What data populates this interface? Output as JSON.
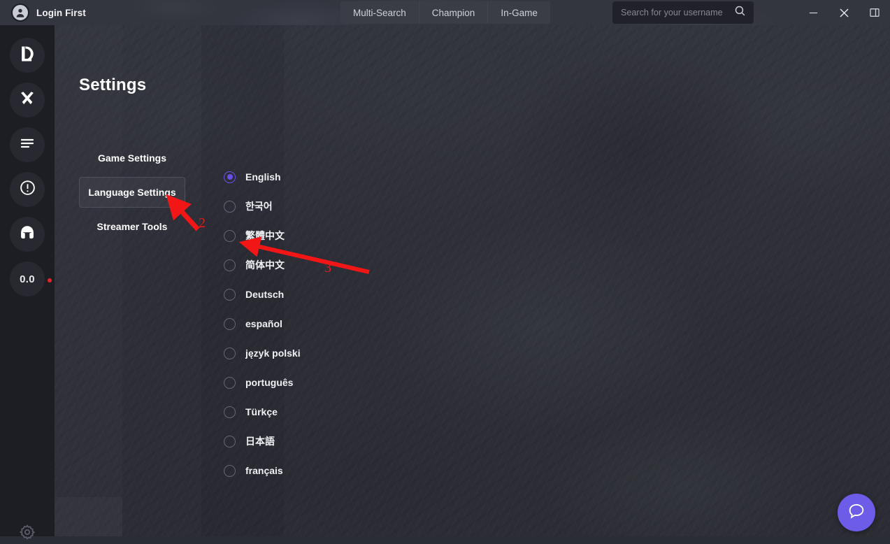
{
  "titlebar": {
    "account_label": "Login First",
    "avatar_icon": "user-avatar-icon",
    "tabs": [
      {
        "label": "Multi-Search",
        "name": "tab-multi-search"
      },
      {
        "label": "Champion",
        "name": "tab-champion"
      },
      {
        "label": "In-Game",
        "name": "tab-in-game"
      }
    ],
    "search": {
      "placeholder": "Search for your username",
      "value": "",
      "icon": "search-icon"
    },
    "window_controls": [
      {
        "name": "minimize-button",
        "icon": "minimize-icon"
      },
      {
        "name": "close-button",
        "icon": "close-icon"
      },
      {
        "name": "toggle-panel-button",
        "icon": "panel-toggle-icon"
      }
    ]
  },
  "rail": {
    "items": [
      {
        "name": "sidebar-item-league",
        "icon": "league-logo-icon",
        "label": ""
      },
      {
        "name": "sidebar-item-tools",
        "icon": "crossed-tools-icon",
        "label": ""
      },
      {
        "name": "sidebar-item-list",
        "icon": "list-lines-icon",
        "label": ""
      },
      {
        "name": "sidebar-item-alert",
        "icon": "exclamation-circle-icon",
        "label": ""
      },
      {
        "name": "sidebar-item-helmet",
        "icon": "helmet-icon",
        "label": ""
      },
      {
        "name": "sidebar-item-score",
        "icon": "",
        "label": "0.0"
      }
    ],
    "notification_dot_color": "#e8252a",
    "gear": {
      "name": "sidebar-settings-gear",
      "icon": "gear-icon"
    }
  },
  "main": {
    "page_title": "Settings",
    "settings_tabs": [
      {
        "label": "Game Settings",
        "name": "tab-game-settings",
        "active": false
      },
      {
        "label": "Language Settings",
        "name": "tab-language-settings",
        "active": true
      },
      {
        "label": "Streamer Tools",
        "name": "tab-streamer-tools",
        "active": false
      }
    ],
    "languages": [
      {
        "label": "English",
        "selected": true
      },
      {
        "label": "한국어",
        "selected": false
      },
      {
        "label": "繁體中文",
        "selected": false
      },
      {
        "label": "简体中文",
        "selected": false
      },
      {
        "label": "Deutsch",
        "selected": false
      },
      {
        "label": "español",
        "selected": false
      },
      {
        "label": "język polski",
        "selected": false
      },
      {
        "label": "português",
        "selected": false
      },
      {
        "label": "Türkçe",
        "selected": false
      },
      {
        "label": "日本語",
        "selected": false
      },
      {
        "label": "français",
        "selected": false
      }
    ],
    "selected_language": "English",
    "accent_color": "#6b4ee8"
  },
  "annotations": {
    "color": "#f21616",
    "items": [
      {
        "number": "2",
        "target": "Language Settings tab"
      },
      {
        "number": "3",
        "target": "简体中文 radio option"
      }
    ]
  },
  "help": {
    "name": "help-chat-button",
    "icon": "chat-bubble-icon",
    "color": "#6c5ce7"
  }
}
